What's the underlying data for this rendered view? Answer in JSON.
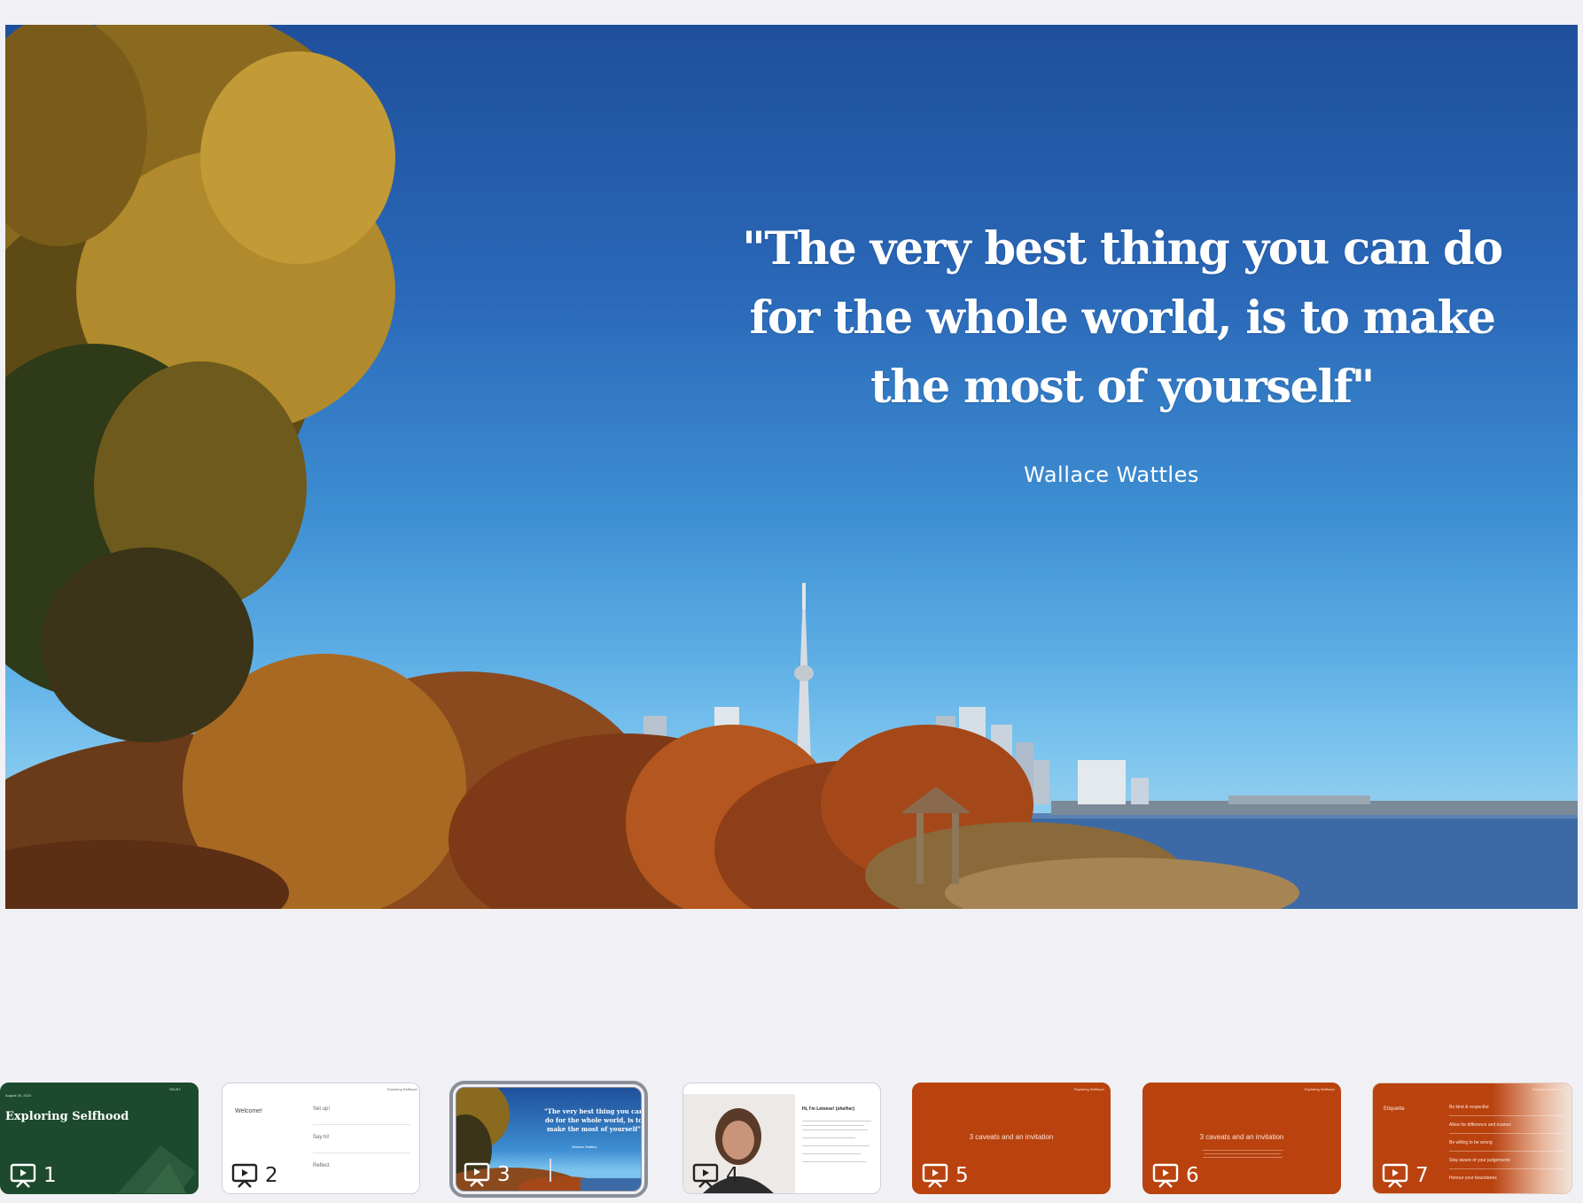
{
  "slide": {
    "quote": "\"The very best thing you can do for the whole world, is to make the most of yourself\"",
    "author": "Wallace Wattles"
  },
  "thumbnails": [
    {
      "number": "1",
      "title": "Exploring Selfhood",
      "date": "August 30, 2023",
      "brand": "SELBY"
    },
    {
      "number": "2",
      "heading": "Welcome!",
      "brand": "Exploring Selfhood",
      "items": [
        "Set up!",
        "Say hi!",
        "Reflect"
      ]
    },
    {
      "number": "3",
      "quote": "\"The very best thing you can do for the whole world, is to make the most of yourself\"",
      "author": "Wallace Wattles"
    },
    {
      "number": "4",
      "heading": "Hi, I'm Leteese! (she/her)"
    },
    {
      "number": "5",
      "heading": "3 caveats and an invitation",
      "brand": "Exploring Selfhood"
    },
    {
      "number": "6",
      "heading": "3 caveats and an invitation",
      "brand": "Exploring Selfhood"
    },
    {
      "number": "7",
      "heading": "Etiquette",
      "brand": "Exploring Selfhood",
      "items": [
        "Be kind & respectful",
        "Allow for difference and nuance",
        "Be willing to be wrong",
        "Stay aware of your judgements",
        "Honour your boundaries"
      ]
    }
  ],
  "colors": {
    "sky_top": "#1f4f9a",
    "sky_bottom": "#8fcdee",
    "green": "#1d4a2e",
    "orange": "#b9420f",
    "selection": "#8a8f99"
  }
}
